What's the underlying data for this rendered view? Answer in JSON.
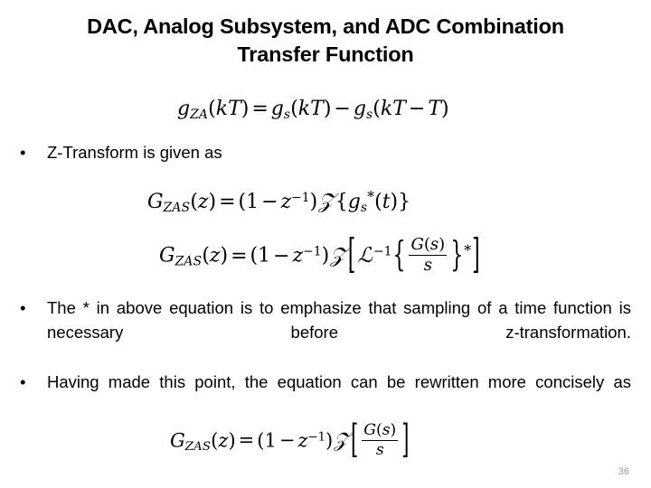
{
  "slide": {
    "title_line1": "DAC, Analog Subsystem, and ADC Combination",
    "title_line2": "Transfer Function",
    "page_number": "36",
    "page_number_color": "#9a9a9a",
    "background_color": "#ffffff",
    "text_color": "#000000"
  },
  "bullets": [
    {
      "marker": "•",
      "text": "Z-Transform is given as"
    },
    {
      "marker": "•",
      "text": "The * in above equation is to emphasize that sampling of a time function is necessary before z-transformation."
    },
    {
      "marker": "•",
      "text": "Having made this point, the equation can be rewritten more concisely as"
    }
  ],
  "equations": [
    {
      "id": "eq-gza-sampled",
      "plain": "g_ZA(kT) = g_s(kT) - g_s(kT - T)",
      "lhs_fn": "g",
      "lhs_sub": "ZA",
      "lhs_arg_open": "(",
      "lhs_arg_k": "k",
      "lhs_arg_T": "T",
      "lhs_arg_close": ")",
      "equals": "=",
      "t1_fn": "g",
      "t1_sub": "s",
      "t1_k": "k",
      "t1_T": "T",
      "minus": "−",
      "t2_fn": "g",
      "t2_sub": "s",
      "t2_k": "k",
      "t2_T": "T",
      "t2_minus": "−",
      "t2_T2": "T"
    },
    {
      "id": "eq-gzas-ztransform-sampled",
      "plain": "G_ZAS(z) = (1 - z^-1) Z{ g_s*(t) }",
      "lhs_fn": "G",
      "lhs_sub": "ZAS",
      "lhs_arg": "z",
      "equals": "=",
      "one": "1",
      "minus": "−",
      "z": "z",
      "zexp": "−1",
      "script_z": "𝒵",
      "brace_open": "{",
      "gs_fn": "g",
      "gs_sub": "s",
      "star": "*",
      "t_arg": "t",
      "brace_close": "}"
    },
    {
      "id": "eq-gzas-laplace-inverse",
      "plain": "G_ZAS(z) = (1 - z^-1) Z [ L^-1 { G(s)/s } ]*",
      "lhs_fn": "G",
      "lhs_sub": "ZAS",
      "lhs_arg": "z",
      "equals": "=",
      "one": "1",
      "minus": "−",
      "z": "z",
      "zexp": "−1",
      "script_z": "𝒵",
      "bracket_open": "[",
      "script_l": "ℒ",
      "lexp": "−1",
      "brace_open": "{",
      "num_G": "G",
      "num_s": "s",
      "den_s": "s",
      "brace_close": "}",
      "star": "*",
      "bracket_close": "]"
    },
    {
      "id": "eq-gzas-concise",
      "plain": "G_ZAS(z) = (1 - z^-1) Z [ G(s)/s ]",
      "lhs_fn": "G",
      "lhs_sub": "ZAS",
      "lhs_arg": "z",
      "equals": "=",
      "one": "1",
      "minus": "−",
      "z": "z",
      "zexp": "−1",
      "script_z": "𝒵",
      "bracket_open": "[",
      "num_G": "G",
      "num_s": "s",
      "den_s": "s",
      "bracket_close": "]"
    }
  ]
}
